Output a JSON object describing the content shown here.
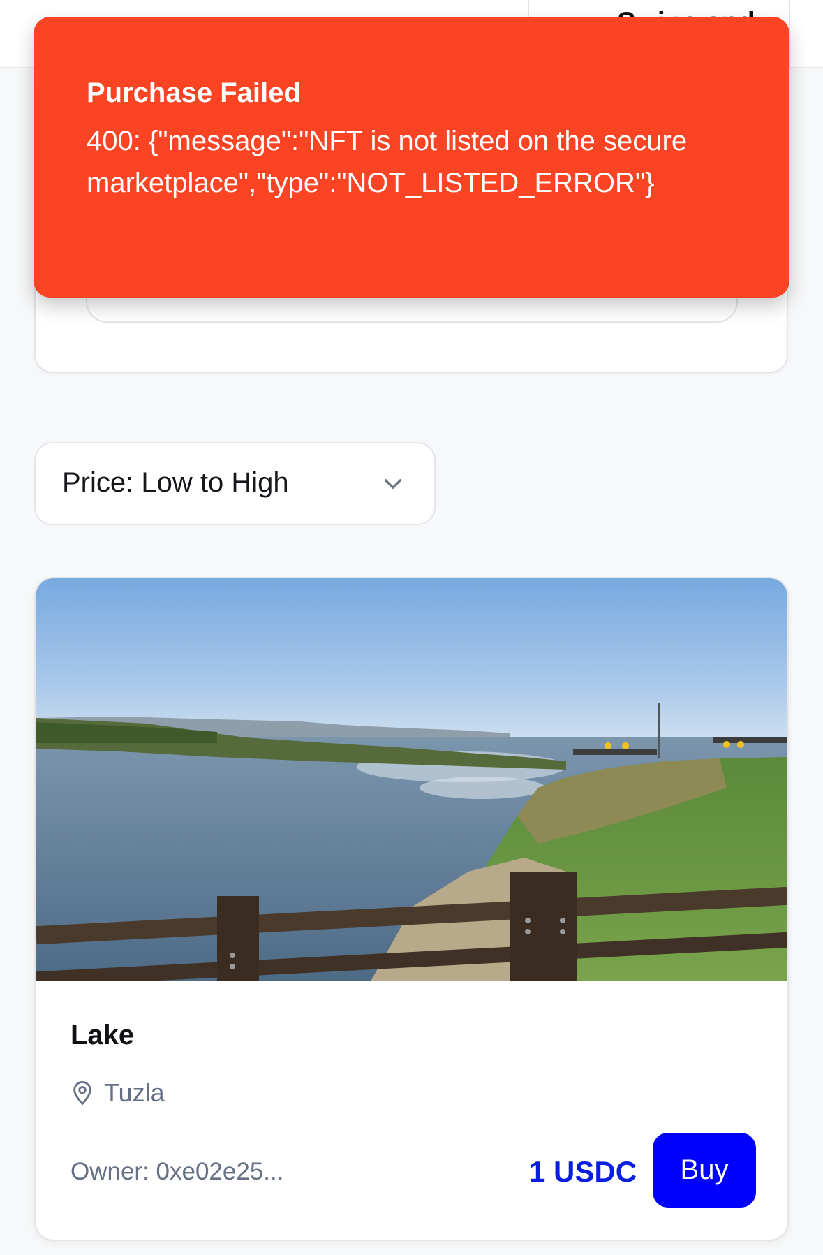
{
  "header": {
    "tab_label": "Swipe and"
  },
  "toast": {
    "title": "Purchase Failed",
    "message": "400: {\"message\":\"NFT is not listed on the secure marketplace\",\"type\":\"NOT_LISTED_ERROR\"}",
    "background_color": "#fa4423"
  },
  "sort": {
    "selected": "Price: Low to High",
    "icon": "chevron-down-icon"
  },
  "listing": {
    "name": "Lake",
    "location_icon": "map-pin-icon",
    "location": "Tuzla",
    "owner": "Owner: 0xe02e25...",
    "price": "1 USDC",
    "buy_label": "Buy",
    "accent_color": "#0000ff"
  }
}
